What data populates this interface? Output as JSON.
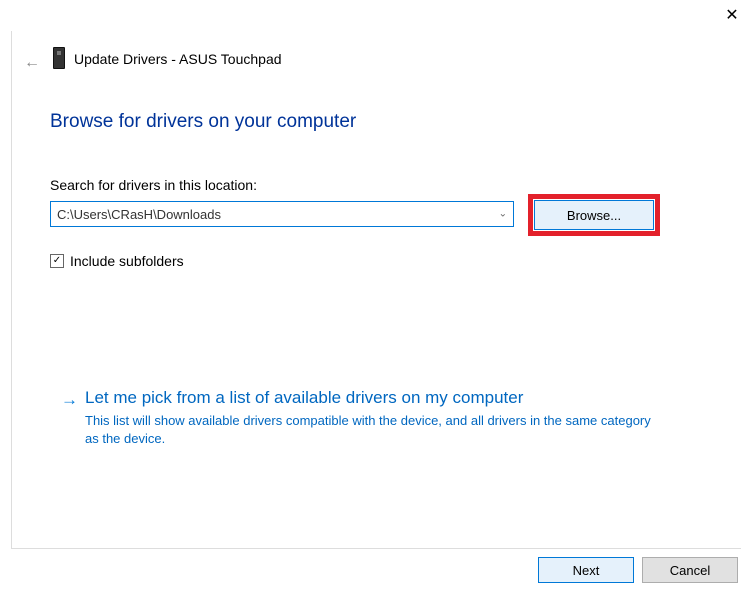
{
  "close_glyph": "✕",
  "back_glyph": "←",
  "window_title": "Update Drivers - ASUS Touchpad",
  "page_title": "Browse for drivers on your computer",
  "search_label": "Search for drivers in this location:",
  "path_value": "C:\\Users\\CRasH\\Downloads",
  "combo_chevron": "⌄",
  "browse_label": "Browse...",
  "include_subfolders": {
    "checked_glyph": "✓",
    "label": "Include subfolders"
  },
  "pick_option": {
    "arrow_glyph": "→",
    "title": "Let me pick from a list of available drivers on my computer",
    "description": "This list will show available drivers compatible with the device, and all drivers in the same category as the device."
  },
  "buttons": {
    "next": "Next",
    "cancel": "Cancel"
  }
}
